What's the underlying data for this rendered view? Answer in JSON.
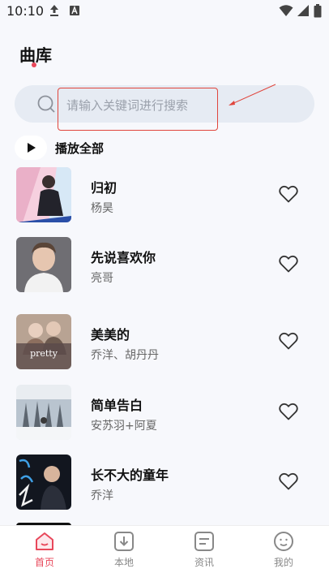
{
  "status_bar": {
    "time": "10:10"
  },
  "header": {
    "title": "曲库"
  },
  "search": {
    "placeholder": "请输入关键词进行搜索"
  },
  "play_all": {
    "label": "播放全部"
  },
  "songs": [
    {
      "title": "归初",
      "artist": "杨昊",
      "cover_color": "#f3c6d8"
    },
    {
      "title": "先说喜欢你",
      "artist": "亮哥",
      "cover_color": "#6b6a6e"
    },
    {
      "title": "美美的",
      "artist": "乔洋、胡丹丹",
      "cover_color": "#b69f8f",
      "cover_text": "pretty"
    },
    {
      "title": "简单告白",
      "artist": "安苏羽+阿夏",
      "cover_color": "#c7cfd8"
    },
    {
      "title": "长不大的童年",
      "artist": "乔洋",
      "cover_color": "#141824"
    }
  ],
  "tabs": [
    {
      "label": "首页",
      "icon": "home-icon",
      "active": true
    },
    {
      "label": "本地",
      "icon": "download-icon",
      "active": false
    },
    {
      "label": "资讯",
      "icon": "news-icon",
      "active": false
    },
    {
      "label": "我的",
      "icon": "profile-icon",
      "active": false
    }
  ],
  "colors": {
    "accent": "#e8475a",
    "annotation": "#e0453c",
    "search_bg": "#e6ebf3"
  }
}
